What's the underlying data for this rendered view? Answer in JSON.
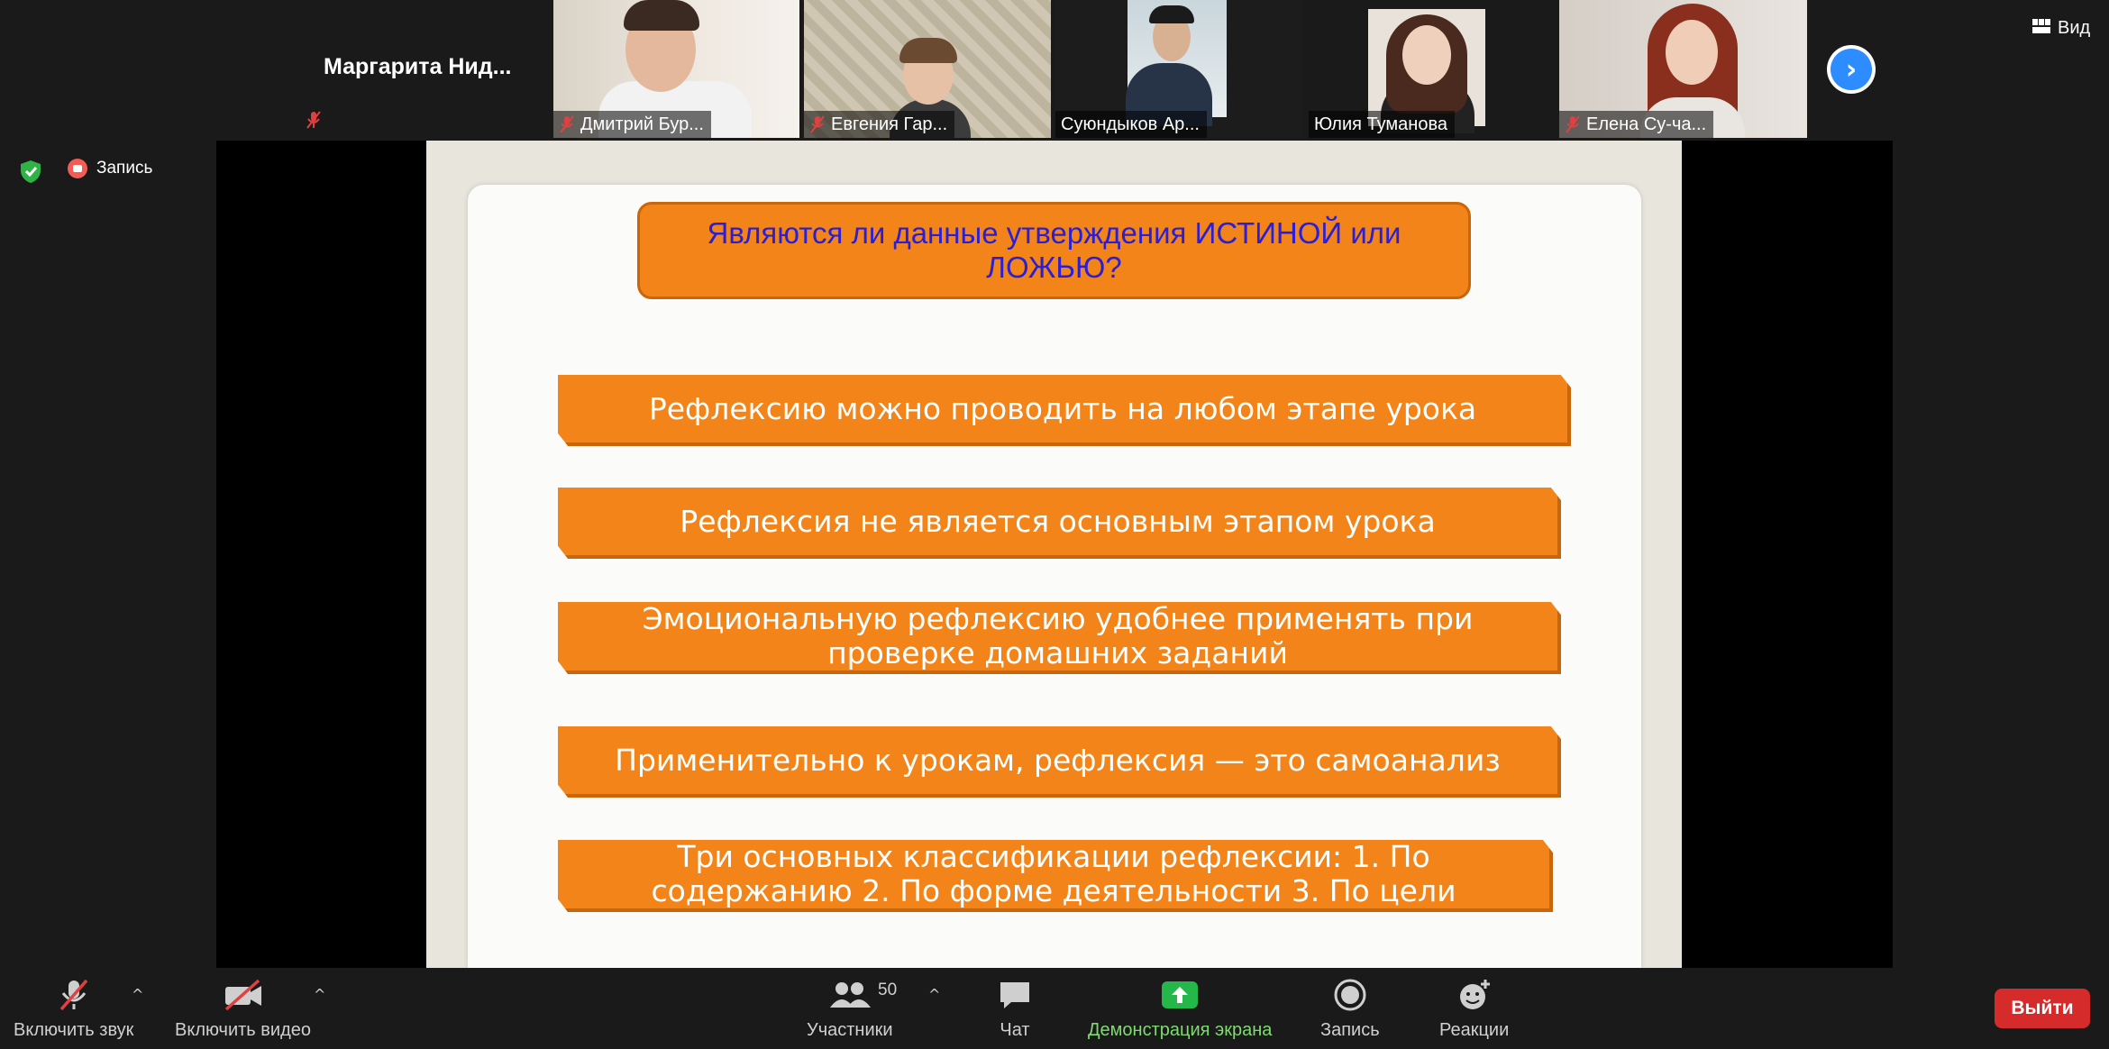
{
  "thumbnails": [
    {
      "name": "Маргарита  Нид...",
      "muted": true,
      "video": false
    },
    {
      "name": "Дмитрий Бур...",
      "muted": true,
      "video": true
    },
    {
      "name": "Евгения Гар...",
      "muted": true,
      "video": true
    },
    {
      "name": "Суюндыков Ар...",
      "muted": false,
      "video": true,
      "active": true
    },
    {
      "name": "Юлия Туманова",
      "muted": false,
      "video": true
    },
    {
      "name": "Елена Су-ча...",
      "muted": true,
      "video": true
    }
  ],
  "view_label": "Вид",
  "recording_label": "Запись",
  "slide": {
    "title": "Являются ли данные утверждения ИСТИНОЙ или ЛОЖЬЮ?",
    "statements": [
      "Рефлексию можно проводить на любом этапе урока",
      "Рефлексия не является основным этапом урока",
      "Эмоциональную рефлексию удобнее применять при проверке домашних заданий",
      "Применительно к урокам, рефлексия — это самоанализ",
      "Три основных классификации рефлексии: 1. По содержанию 2. По форме деятельности 3. По цели"
    ]
  },
  "toolbar": {
    "unmute": "Включить звук",
    "start_video": "Включить видео",
    "participants": "Участники",
    "participants_count": "50",
    "chat": "Чат",
    "share_screen": "Демонстрация экрана",
    "record": "Запись",
    "reactions": "Реакции",
    "leave": "Выйти"
  },
  "colors": {
    "slide_orange": "#f2841a",
    "title_text": "#2a1fd6",
    "leave_red": "#d62b2b",
    "share_green": "#24b84a",
    "next_blue": "#2d8cff"
  }
}
